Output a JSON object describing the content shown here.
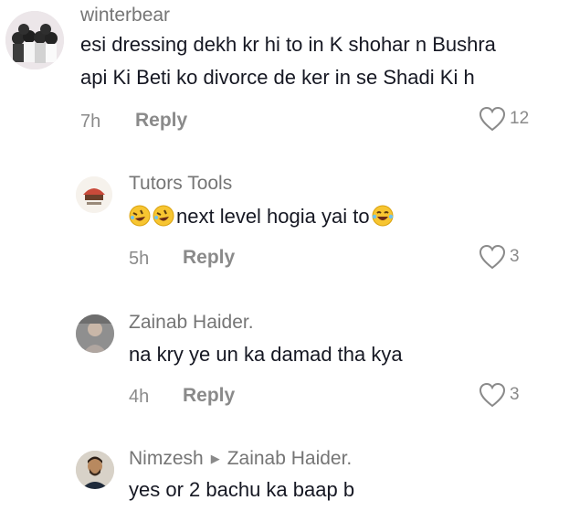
{
  "comments": [
    {
      "username": "winterbear",
      "lines": [
        "esi dressing dekh kr hi to in K shohar n Bushra",
        "api Ki Beti ko divorce de ker in se Shadi Ki h"
      ],
      "time": "7h",
      "reply_label": "Reply",
      "likes": "12"
    },
    {
      "username": "Tutors Tools",
      "text": "next level hogia yai to",
      "emoji_before": [
        "rolling-on-floor-laughing",
        "rolling-on-floor-laughing"
      ],
      "emoji_after": [
        "face-with-tears-of-joy"
      ],
      "time": "5h",
      "reply_label": "Reply",
      "likes": "3"
    },
    {
      "username": "Zainab Haider.",
      "text": "na kry ye un ka damad tha kya",
      "time": "4h",
      "reply_label": "Reply",
      "likes": "3"
    },
    {
      "username": "Nimzesh",
      "reply_to": "Zainab Haider.",
      "text": "yes or 2 bachu ka baap b"
    }
  ],
  "icons": {
    "like": "heart-outline-icon",
    "reply_to": "triangle-right-icon"
  },
  "colors": {
    "text": "#161823",
    "muted": "#8a8a8a",
    "username": "#757575"
  }
}
